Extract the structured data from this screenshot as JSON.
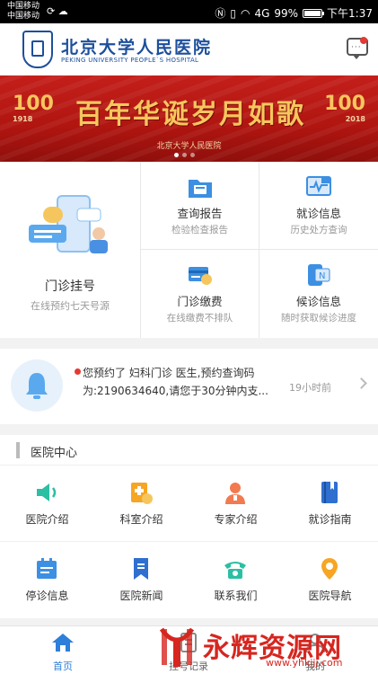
{
  "status_bar": {
    "carrier1": "中国移动",
    "carrier2": "中国移动",
    "signal_label": "4G",
    "battery": "99%",
    "time": "下午1:37"
  },
  "header": {
    "logo_cn": "北京大学人民医院",
    "logo_en": "PEKING UNIVERSITY PEOPLE`S HOSPITAL",
    "message_icon": "message-icon"
  },
  "banner": {
    "title": "百年华诞岁月如歌",
    "subtitle": "北京大学人民医院",
    "left_num": "100",
    "left_year": "1918",
    "right_num": "100",
    "right_year": "2018",
    "slide_count": 3,
    "active_slide": 1
  },
  "services": {
    "big": {
      "title": "门诊挂号",
      "subtitle": "在线预约七天号源"
    },
    "items": [
      {
        "title": "查询报告",
        "subtitle": "检验检查报告",
        "icon": "folder-report-icon"
      },
      {
        "title": "就诊信息",
        "subtitle": "历史处方查询",
        "icon": "monitor-heart-icon"
      },
      {
        "title": "门诊缴费",
        "subtitle": "在线缴费不排队",
        "icon": "payment-card-icon"
      },
      {
        "title": "候诊信息",
        "subtitle": "随时获取候诊进度",
        "icon": "phone-n-icon"
      }
    ]
  },
  "notice": {
    "line1": "您预约了 妇科门诊 医生,预约查询码",
    "line2": "为:2190634640,请您于30分钟内支...",
    "time": "19小时前"
  },
  "hospital_center": {
    "title": "医院中心",
    "items": [
      {
        "label": "医院介绍",
        "icon": "speaker-icon"
      },
      {
        "label": "科室介绍",
        "icon": "department-icon"
      },
      {
        "label": "专家介绍",
        "icon": "doctor-icon"
      },
      {
        "label": "就诊指南",
        "icon": "guide-book-icon"
      },
      {
        "label": "停诊信息",
        "icon": "calendar-icon"
      },
      {
        "label": "医院新闻",
        "icon": "news-bookmark-icon"
      },
      {
        "label": "联系我们",
        "icon": "telephone-icon"
      },
      {
        "label": "医院导航",
        "icon": "location-pin-icon"
      }
    ]
  },
  "bottom_nav": {
    "tabs": [
      {
        "label": "首页",
        "active": true
      },
      {
        "label": "挂号记录",
        "active": false
      },
      {
        "label": "我的",
        "active": false
      }
    ]
  },
  "watermark": {
    "text": "永辉资源网",
    "url": "www.yhkjjj.com"
  },
  "colors": {
    "brand_blue": "#1d4f9c",
    "accent_blue": "#2e7fd9",
    "banner_red": "#c41f1a",
    "gold": "#f6c65e",
    "badge_red": "#e53935"
  }
}
